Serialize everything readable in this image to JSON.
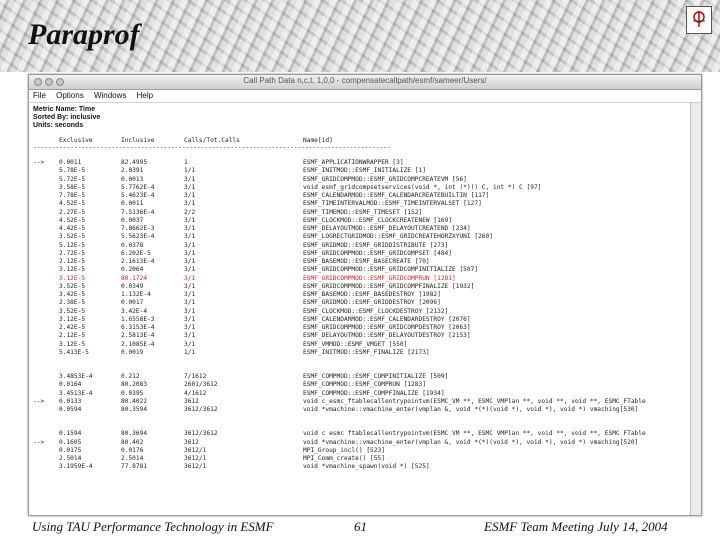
{
  "slide": {
    "title": "Paraprof",
    "footer_left": "Using TAU Performance Technology in ESMF",
    "footer_center": "61",
    "footer_right": "ESMF Team Meeting July 14, 2004"
  },
  "window": {
    "title": "Call Path Data n,c,t, 1,0,0 - compensatecallpath/esmf/sameer/Users/",
    "menu": [
      "File",
      "Options",
      "Windows",
      "Help"
    ]
  },
  "report": {
    "metric_line": "Metric Name: Time",
    "sorted_line": "Sorted By: inclusive",
    "units_line": "Units: seconds",
    "columns": [
      "Exclusive",
      "Inclusive",
      "Calls/Tot.Calls",
      "Name[id]"
    ],
    "separator": "------------------------------------------------------------------------------------------------",
    "block1": [
      {
        "mark": "-->",
        "exclusive": "0.0011",
        "inclusive": "82.4995",
        "calls": "1",
        "name": "ESMF_APPLICATIONWRAPPER  [3]"
      },
      {
        "mark": "",
        "exclusive": "5.78E-5",
        "inclusive": "2.0391",
        "calls": "1/1",
        "name": "ESMF_INITMOD::ESMF_INITIALIZE  [1]"
      },
      {
        "mark": "",
        "exclusive": "5.72E-5",
        "inclusive": "0.0013",
        "calls": "3/1",
        "name": "ESMF_GRIDCOMPMOD::ESMF_GRIDCOMPCREATEVM  [56]"
      },
      {
        "mark": "",
        "exclusive": "3.58E-5",
        "inclusive": "5.7762E-4",
        "calls": "3/1",
        "name": "void esmf_gridcompsetservices(void *, int (*)() C, int *) C  [97]"
      },
      {
        "mark": "",
        "exclusive": "7.78E-5",
        "inclusive": "5.4623E-4",
        "calls": "3/1",
        "name": "ESMF_CALENDARMOD::ESMF_CALENDARCREATEBUILTIN  [117]"
      },
      {
        "mark": "",
        "exclusive": "4.52E-5",
        "inclusive": "0.0011",
        "calls": "3/1",
        "name": "ESMF_TIMEINTERVALMOD::ESMF_TIMEINTERVALSET  [127]"
      },
      {
        "mark": "",
        "exclusive": "2.27E-5",
        "inclusive": "7.5136E-4",
        "calls": "2/2",
        "name": "ESMF_TIMEMOD::ESMF_TIMESET  [152]"
      },
      {
        "mark": "",
        "exclusive": "4.52E-5",
        "inclusive": "0.0037",
        "calls": "3/1",
        "name": "ESMF_CLOCKMOD::ESMF_CLOCKCREATENEW  [169]"
      },
      {
        "mark": "",
        "exclusive": "4.42E-5",
        "inclusive": "7.8662E-3",
        "calls": "3/1",
        "name": "ESMF_DELAYOUTMOD::ESMF_DELAYOUTCREATEND  [234]"
      },
      {
        "mark": "",
        "exclusive": "3.52E-5",
        "inclusive": "5.5623E-4",
        "calls": "3/1",
        "name": "ESMF_LOGRECTGRIDMOD::ESMF_GRIDCREATEHORZXYUNI  [260]"
      },
      {
        "mark": "",
        "exclusive": "5.12E-5",
        "inclusive": "0.0378",
        "calls": "3/1",
        "name": "ESMF_GRIDMOD::ESMF_GRIDDISTRIBUTE  [273]"
      },
      {
        "mark": "",
        "exclusive": "2.72E-5",
        "inclusive": "6.202E-5",
        "calls": "3/1",
        "name": "ESMF_GRIDCOMPMOD::ESMF_GRIDCOMPSET  [484]"
      },
      {
        "mark": "",
        "exclusive": "2.12E-5",
        "inclusive": "2.1613E-4",
        "calls": "3/1",
        "name": "ESMF_BASEMOD::ESMF_BASECREATE  [70]"
      },
      {
        "mark": "",
        "exclusive": "3.12E-5",
        "inclusive": "0.2064",
        "calls": "3/1",
        "name": "ESMF_GRIDCOMPMOD::ESMF_GRIDCOMPINITIALIZE  [507]"
      },
      {
        "mark": "",
        "exclusive": "3.12E-5",
        "inclusive": "80.1724",
        "calls": "3/1",
        "name": "ESMF_GRIDCOMPMOD::ESMF_GRIDCOMPRUN  [1281]",
        "red": true
      },
      {
        "mark": "",
        "exclusive": "3.52E-5",
        "inclusive": "0.0349",
        "calls": "3/1",
        "name": "ESMF_GRIDCOMPMOD::ESMF_GRIDCOMPFINALIZE  [1932]"
      },
      {
        "mark": "",
        "exclusive": "3.42E-5",
        "inclusive": "1.132E-4",
        "calls": "3/1",
        "name": "ESMF_BASEMOD::ESMF_BASEDESTROY  [1982]"
      },
      {
        "mark": "",
        "exclusive": "2.38E-5",
        "inclusive": "0.0017",
        "calls": "3/1",
        "name": "ESMF_GRIDMOD::ESMF_GRIDDESTROY  [2096]"
      },
      {
        "mark": "",
        "exclusive": "3.52E-5",
        "inclusive": "3.42E-4",
        "calls": "3/1",
        "name": "ESMF_CLOCKMOD::ESMF_CLOCKDESTROY  [2132]"
      },
      {
        "mark": "",
        "exclusive": "3.12E-5",
        "inclusive": "1.6558E-3",
        "calls": "3/1",
        "name": "ESMF_CALENDARMOD::ESMF_CALENDARDESTROY  [2076]"
      },
      {
        "mark": "",
        "exclusive": "2.42E-5",
        "inclusive": "6.3153E-4",
        "calls": "3/1",
        "name": "ESMF_GRIDCOMPMOD::ESMF_GRIDCOMPDESTROY  [2063]"
      },
      {
        "mark": "",
        "exclusive": "2.12E-5",
        "inclusive": "2.5813E-4",
        "calls": "3/1",
        "name": "ESMF_DELAYOUTMOD::ESMF_DELAYOUTDESTROY  [2153]"
      },
      {
        "mark": "",
        "exclusive": "3.12E-5",
        "inclusive": "2.1085E-4",
        "calls": "3/1",
        "name": "ESMF_VMMOD::ESMF_VMGET  [550]"
      },
      {
        "mark": "",
        "exclusive": "5.413E-5",
        "inclusive": "0.0019",
        "calls": "1/1",
        "name": "ESMF_INITMOD::ESMF_FINALIZE  [2173]"
      }
    ],
    "block2": [
      {
        "mark": "",
        "exclusive": "3.4853E-4",
        "inclusive": "0.212",
        "calls": "7/1612",
        "name": "ESMF_COMPMOD::ESMF_COMPINITIALIZE  [509]"
      },
      {
        "mark": "",
        "exclusive": "0.0164",
        "inclusive": "80.2083",
        "calls": "2601/3612",
        "name": "ESMF_COMPMOD::ESMF_COMPRUN  [1283]"
      },
      {
        "mark": "",
        "exclusive": "3.4513E-4",
        "inclusive": "0.0395",
        "calls": "4/1612",
        "name": "ESMF_COMPMOD::ESMF_COMPFINALIZE  [1934]"
      },
      {
        "mark": "-->",
        "exclusive": "0.0133",
        "inclusive": "80.4022",
        "calls": "3612",
        "name": "void c_esmc_ftablecallentrypointvm(ESMC_VM **, ESMC_VMPlan **, void **, void **, ESMC_FTable"
      },
      {
        "mark": "",
        "exclusive": "0.0594",
        "inclusive": "80.3594",
        "calls": "3612/3612",
        "name": "void *vmachine::vmachine_enter(vmplan &, void *(*)(void *), void *), void *) vmaching[530]"
      }
    ],
    "block3": [
      {
        "mark": "",
        "exclusive": "0.1594",
        "inclusive": "80.3694",
        "calls": "3612/3612",
        "name": "void c esmc ftablecallentrypointvm(ESMC VM **, ESMC VMPlan **, void **, void **, ESMC FTable"
      },
      {
        "mark": "-->",
        "exclusive": "0.1605",
        "inclusive": "80.402",
        "calls": "3612",
        "name": "void *vmachine::vmachine_enter(vmplan &, void *(*)(void *), void *), void *) vmaching[520]"
      },
      {
        "mark": "",
        "exclusive": "0.0175",
        "inclusive": "0.0176",
        "calls": "3612/1",
        "name": "MPI_Group_incl()  [523]"
      },
      {
        "mark": "",
        "exclusive": "2.5014",
        "inclusive": "2.5014",
        "calls": "3612/1",
        "name": "MPI_Comm_create()  [55]"
      },
      {
        "mark": "",
        "exclusive": "3.1959E-4",
        "inclusive": "77.8781",
        "calls": "3612/1",
        "name": "void *vmachine_spawn(void *)  [525]"
      }
    ]
  }
}
